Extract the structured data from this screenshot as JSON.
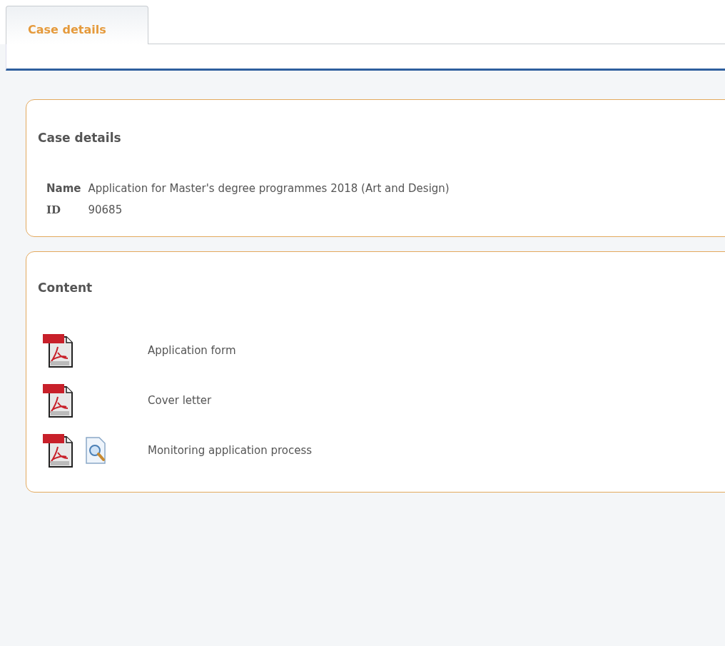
{
  "tabs": [
    {
      "label": "Case details",
      "selected": true
    }
  ],
  "case_details": {
    "title": "Case details",
    "fields": [
      {
        "label": "Name",
        "value": "Application for Master's degree programmes 2018 (Art and Design)"
      },
      {
        "label": "ID",
        "value": "90685"
      }
    ]
  },
  "content": {
    "title": "Content",
    "items": [
      {
        "label": "Application form",
        "preview": false
      },
      {
        "label": "Cover letter",
        "preview": false
      },
      {
        "label": "Monitoring application process",
        "preview": true
      }
    ]
  }
}
